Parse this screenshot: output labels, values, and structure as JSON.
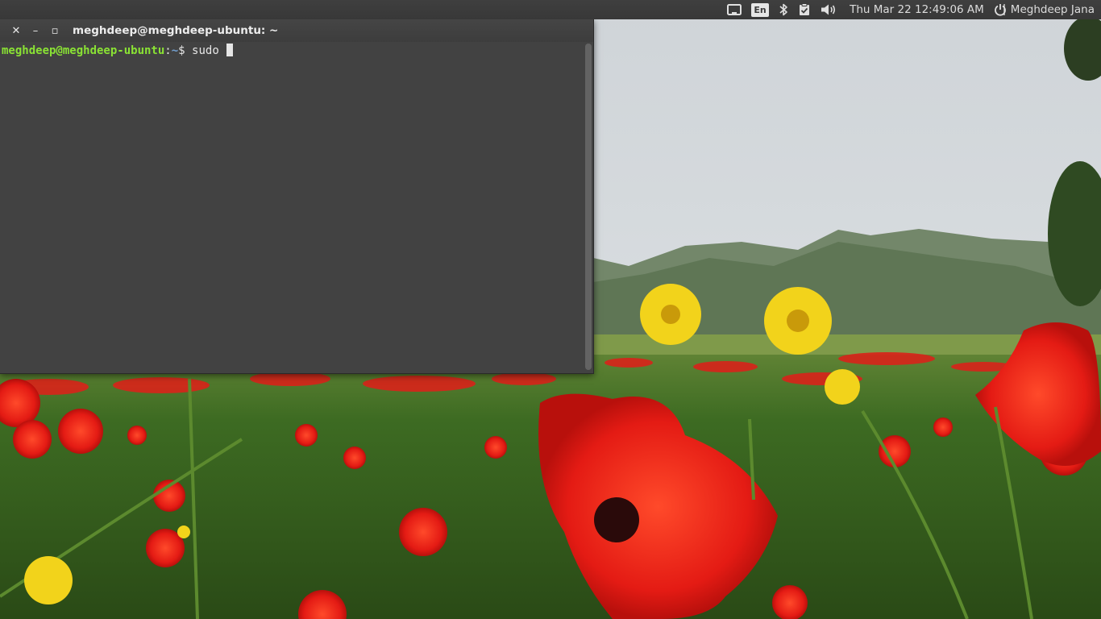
{
  "panel": {
    "clock": "Thu Mar 22 12:49:06 AM",
    "user_name": "Meghdeep Jana",
    "language": "En",
    "icons": [
      "network-icon",
      "keyboard-language-icon",
      "bluetooth-icon",
      "updates-check-icon",
      "volume-icon",
      "power-icon"
    ]
  },
  "terminal": {
    "title": "meghdeep@meghdeep-ubuntu: ~",
    "prompt_user": "meghdeep@meghdeep-ubuntu",
    "prompt_colon": ":",
    "prompt_path": "~",
    "prompt_symbol": "$",
    "command": "sudo ",
    "controls": {
      "close": "✕",
      "minimize": "–",
      "maximize": "▫"
    }
  },
  "colors": {
    "panel_bg": "#3c3c3c",
    "terminal_bg": "#424242",
    "prompt_user": "#8ae234",
    "prompt_path": "#729fcf",
    "poppy_red": "#e8201a",
    "dandelion_yellow": "#f2d31b",
    "sky": "#d3d9dc"
  }
}
